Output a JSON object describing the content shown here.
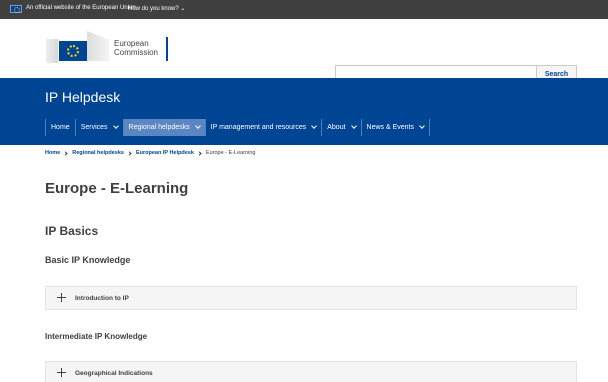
{
  "official_bar": {
    "text": "An official website of the European Union",
    "link": "How do you know? ⌄"
  },
  "header": {
    "logo_text": "European\nCommission",
    "search_placeholder": "",
    "search_button": "Search"
  },
  "site": {
    "title": "IP Helpdesk"
  },
  "nav": {
    "items": [
      {
        "label": "Home",
        "has_dropdown": false,
        "active": false
      },
      {
        "label": "Services",
        "has_dropdown": true,
        "active": false
      },
      {
        "label": "Regional helpdesks",
        "has_dropdown": true,
        "active": true
      },
      {
        "label": "IP management and resources",
        "has_dropdown": true,
        "active": false
      },
      {
        "label": "About",
        "has_dropdown": true,
        "active": false
      },
      {
        "label": "News & Events",
        "has_dropdown": true,
        "active": false
      }
    ]
  },
  "breadcrumb": {
    "items": [
      "Home",
      "Regional helpdesks",
      "European IP Helpdesk"
    ],
    "current": "Europe - E-Learning"
  },
  "content": {
    "page_title": "Europe - E-Learning",
    "section_title": "IP Basics",
    "subsection_1": "Basic IP Knowledge",
    "accordion_1": "Introduction to IP",
    "subsection_2": "Intermediate IP Knowledge",
    "accordion_2": "Geographical Indications"
  },
  "colors": {
    "brand_blue": "#004494",
    "active_nav": "#5b86c1",
    "top_bar": "#404040"
  }
}
